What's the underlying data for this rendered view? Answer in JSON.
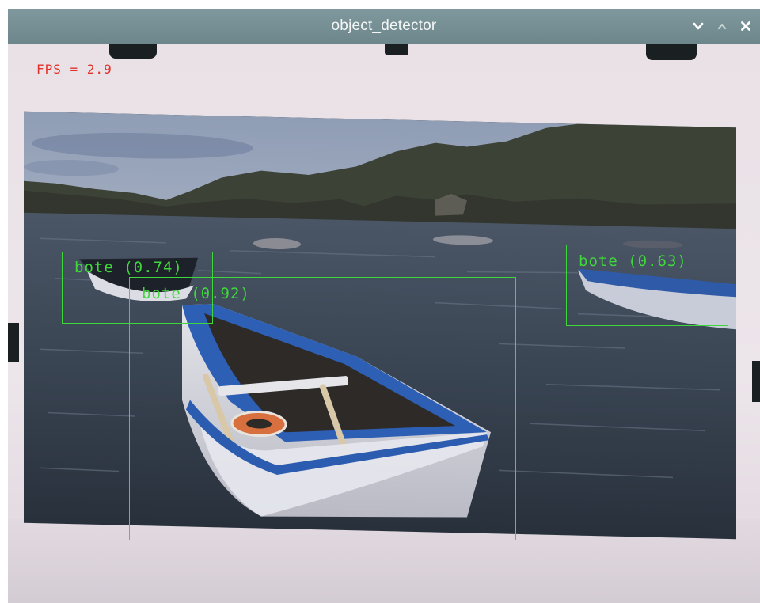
{
  "window": {
    "title": "object_detector",
    "controls": [
      "chevron-down-icon",
      "chevron-up-icon",
      "close-icon"
    ]
  },
  "overlay": {
    "fps_text": "FPS = 2.9",
    "fps_color": "#e0322a",
    "box_color": "#3fd83b"
  },
  "detections": [
    {
      "label": "bote (0.74)"
    },
    {
      "label": "bote (0.92)"
    },
    {
      "label": "bote (0.63)"
    }
  ]
}
